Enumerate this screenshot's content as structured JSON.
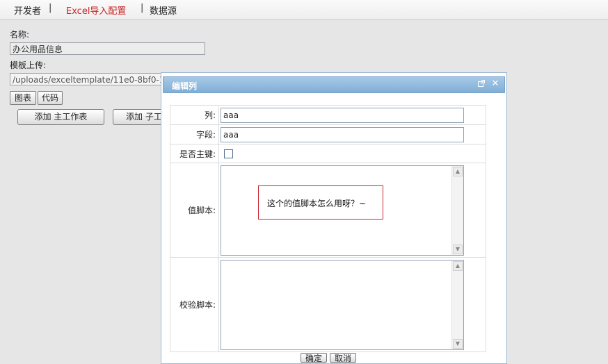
{
  "nav": {
    "tabs": [
      "开发者",
      "Excel导入配置",
      "数据源"
    ],
    "separator": "|"
  },
  "form": {
    "name_label": "名称:",
    "name_value": "办公用品信息",
    "template_label": "模板上传:",
    "template_value": "/uploads/exceltemplate/11e0-8bf0-19",
    "chart_button": "图表",
    "code_button": "代码",
    "add_main_sheet": "添加 主工作表",
    "add_sub_sheet": "添加 子工"
  },
  "dialog": {
    "title": "编辑列",
    "column_label": "列:",
    "column_value": "aaa",
    "field_label": "字段:",
    "field_value": "aaa",
    "primary_key_label": "是否主键:",
    "value_script_label": "值脚本:",
    "validate_script_label": "校验脚本:",
    "confirm_button": "确定",
    "cancel_button": "取消"
  },
  "annotation": {
    "text": "这个的值脚本怎么用呀？~"
  },
  "colors": {
    "active_tab": "#cc2222",
    "dialog_title_bg": "#80aed6",
    "annotation_border": "#c8262e"
  }
}
